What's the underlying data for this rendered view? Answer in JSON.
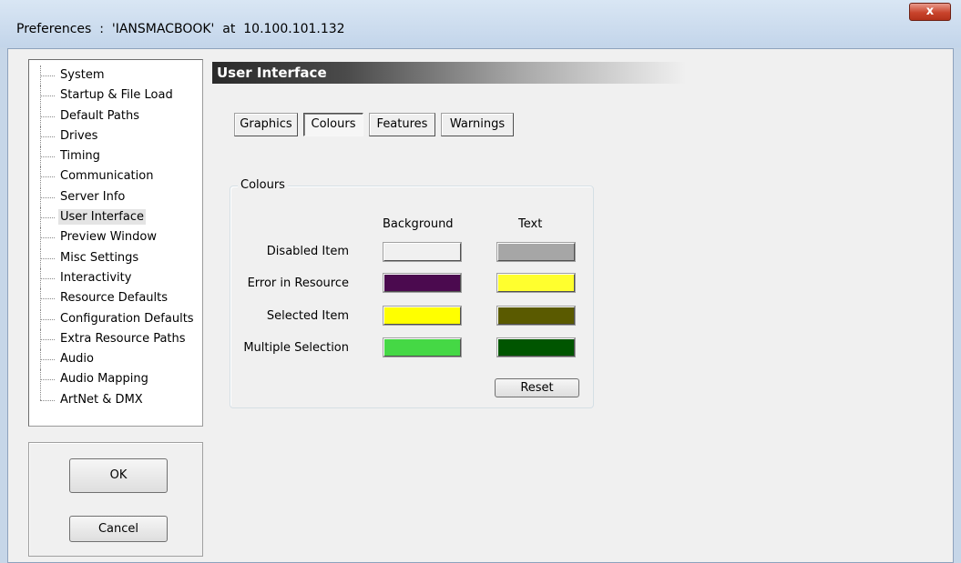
{
  "window": {
    "title": "Preferences  :  'IANSMACBOOK'  at  10.100.101.132",
    "close_glyph": "x"
  },
  "tree": {
    "selected": "User Interface",
    "items": [
      {
        "label": "System"
      },
      {
        "label": "Startup & File Load"
      },
      {
        "label": "Default Paths"
      },
      {
        "label": "Drives"
      },
      {
        "label": "Timing"
      },
      {
        "label": "Communication"
      },
      {
        "label": "Server Info"
      },
      {
        "label": "User Interface"
      },
      {
        "label": "Preview Window"
      },
      {
        "label": "Misc Settings"
      },
      {
        "label": "Interactivity"
      },
      {
        "label": "Resource Defaults"
      },
      {
        "label": "Configuration Defaults"
      },
      {
        "label": "Extra Resource Paths"
      },
      {
        "label": "Audio"
      },
      {
        "label": "Audio Mapping"
      },
      {
        "label": "ArtNet & DMX"
      }
    ]
  },
  "buttons": {
    "ok": "OK",
    "cancel": "Cancel"
  },
  "section": {
    "title": "User Interface"
  },
  "tabs": {
    "active": "Colours",
    "items": [
      {
        "label": "Graphics"
      },
      {
        "label": "Colours"
      },
      {
        "label": "Features"
      },
      {
        "label": "Warnings"
      }
    ]
  },
  "colours": {
    "group_title": "Colours",
    "background_header": "Background",
    "text_header": "Text",
    "rows": [
      {
        "label": "Disabled Item",
        "background": "#f0f0f0",
        "text": "#a6a6a6"
      },
      {
        "label": "Error in Resource",
        "background": "#4b0a4f",
        "text": "#ffff2e"
      },
      {
        "label": "Selected Item",
        "background": "#ffff00",
        "text": "#5a5a00"
      },
      {
        "label": "Multiple Selection",
        "background": "#45d845",
        "text": "#005500"
      }
    ],
    "reset_label": "Reset"
  }
}
